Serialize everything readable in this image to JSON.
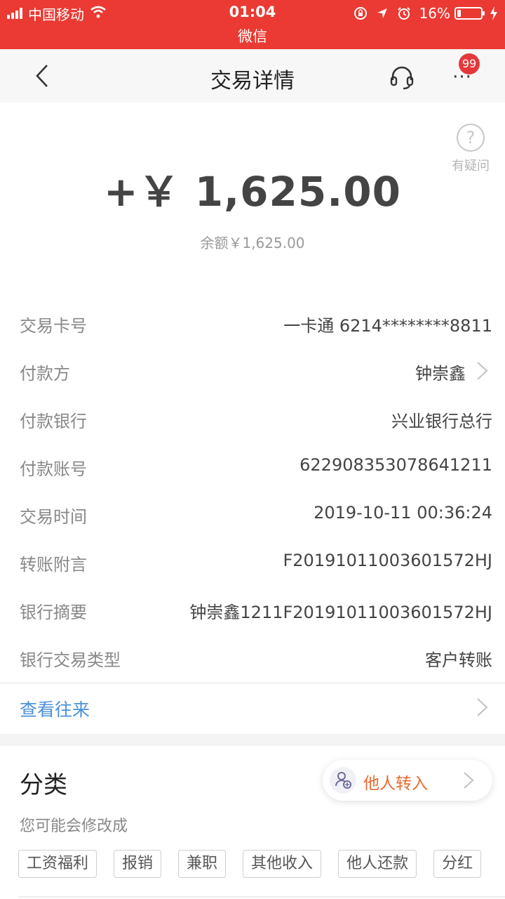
{
  "status_bar": {
    "carrier": "中国移动",
    "time": "01:04",
    "app": "微信",
    "battery": "16%",
    "battery_level": 0.16,
    "icons": [
      "signal-icon",
      "wifi-icon",
      "rotation-lock-icon",
      "location-icon",
      "alarm-icon",
      "battery-icon",
      "charging-icon"
    ]
  },
  "nav": {
    "title": "交易详情",
    "badge": "99",
    "more": "···",
    "icons": [
      "back-icon",
      "headset-icon",
      "more-icon"
    ]
  },
  "amount_card": {
    "amount": "+￥ 1,625.00",
    "balance": "余额￥1,625.00",
    "help_label": "有疑问",
    "help_glyph": "?"
  },
  "details": [
    {
      "label": "交易卡号",
      "value": "一卡通 6214********8811"
    },
    {
      "label": "付款方",
      "value": "钟崇鑫"
    },
    {
      "label": "付款银行",
      "value": "兴业银行总行"
    },
    {
      "label": "付款账号",
      "value": "622908353078641211"
    },
    {
      "label": "交易时间",
      "value": "2019-10-11 00:36:24"
    },
    {
      "label": "转账附言",
      "value": "F20191011003601572HJ"
    },
    {
      "label": "银行摘要",
      "value": "钟崇鑫1211F20191011003601572HJ"
    },
    {
      "label": "银行交易类型",
      "value": "客户转账"
    }
  ],
  "history": {
    "label": "查看往来"
  },
  "category": {
    "title": "分类",
    "selected": "他人转入",
    "hint": "您可能会修改成",
    "tags": [
      "工资福利",
      "报销",
      "兼职",
      "其他收入",
      "他人还款",
      "分红"
    ]
  },
  "colors": {
    "status_bar_bg": "#ea3a33",
    "badge": "#e5383b",
    "link_blue": "#4a90d9",
    "category_orange": "#e96a2e"
  }
}
